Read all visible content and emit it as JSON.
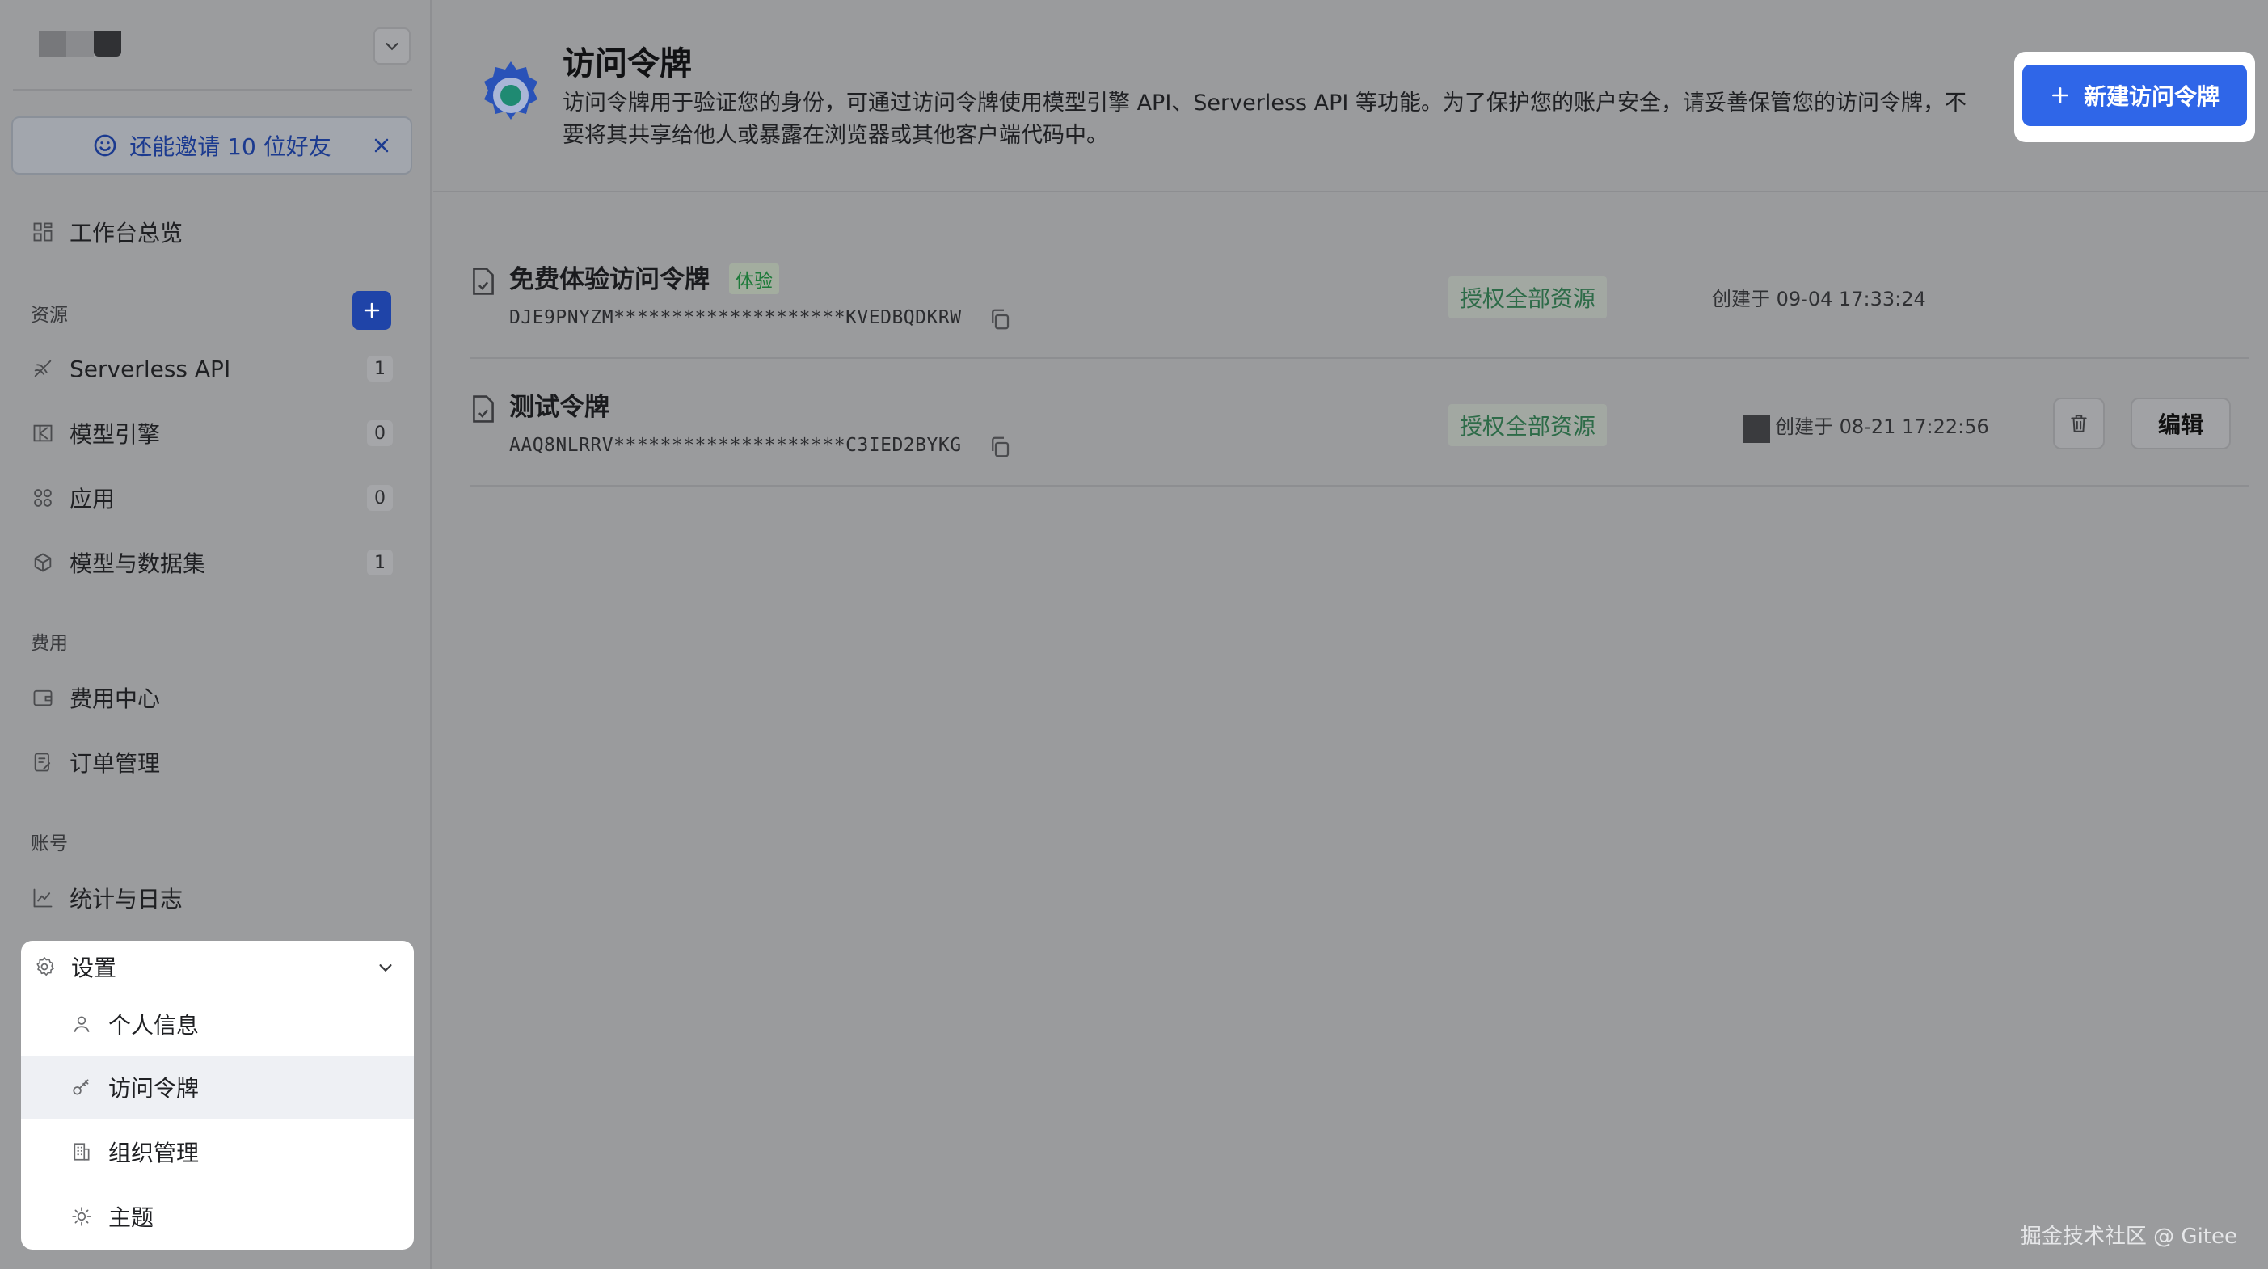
{
  "sidebar": {
    "invite_text": "还能邀请 10 位好友",
    "overview": "工作台总览",
    "section_resources": "资源",
    "resources": [
      {
        "label": "Serverless API",
        "count": "1",
        "icon": "serverless-icon"
      },
      {
        "label": "模型引擎",
        "count": "0",
        "icon": "engine-icon"
      },
      {
        "label": "应用",
        "count": "0",
        "icon": "apps-icon"
      },
      {
        "label": "模型与数据集",
        "count": "1",
        "icon": "cube-icon"
      }
    ],
    "section_billing": "费用",
    "billing": [
      {
        "label": "费用中心",
        "icon": "wallet-icon"
      },
      {
        "label": "订单管理",
        "icon": "order-icon"
      }
    ],
    "section_account": "账号",
    "stats": "统计与日志",
    "settings": {
      "label": "设置",
      "items": [
        {
          "label": "个人信息",
          "icon": "user-icon"
        },
        {
          "label": "访问令牌",
          "icon": "key-icon",
          "active": true
        },
        {
          "label": "组织管理",
          "icon": "building-icon"
        },
        {
          "label": "主题",
          "icon": "sun-icon"
        }
      ]
    }
  },
  "header": {
    "title": "访问令牌",
    "description": "访问令牌用于验证您的身份，可通过访问令牌使用模型引擎 API、Serverless API 等功能。为了保护您的账户安全，请妥善保管您的访问令牌，不要将其共享给他人或暴露在浏览器或其他客户端代码中。",
    "new_button": "新建访问令牌"
  },
  "tokens": [
    {
      "name": "免费体验访问令牌",
      "badge": "体验",
      "value": "DJE9PNYZM********************KVEDBQDKRW",
      "scope": "授权全部资源",
      "created": "创建于 09-04 17:33:24"
    },
    {
      "name": "测试令牌",
      "value": "AAQ8NLRRV********************C3IED2BYKG",
      "scope": "授权全部资源",
      "created": "创建于 08-21 17:22:56",
      "edit_label": "编辑"
    }
  ],
  "watermark": "掘金技术社区 @ Gitee",
  "colors": {
    "accent": "#2f66e8",
    "scope_text": "#2d6b48",
    "badge_text": "#1e7a3a"
  }
}
